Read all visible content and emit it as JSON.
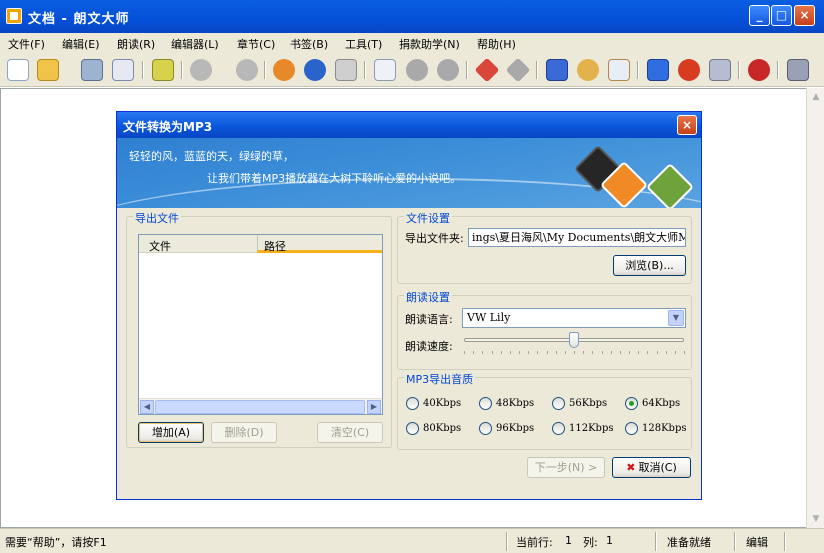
{
  "window": {
    "title": "文档 - 朗文大师"
  },
  "menu": [
    "文件(F)",
    "编辑(E)",
    "朗读(R)",
    "编辑器(L)",
    "章节(C)",
    "书签(B)",
    "工具(T)",
    "捐款助学(N)",
    "帮助(H)"
  ],
  "toolbar_icons": [
    "new-file-icon",
    "open-folder-icon",
    "save-icon",
    "edit-doc-icon",
    "convert-icon",
    "play-icon",
    "stop-icon",
    "voices-icon",
    "speed-icon",
    "volume-icon",
    "list-icon",
    "up-icon",
    "down-icon",
    "bookmark-icon",
    "bookmark-gray-icon",
    "font-icon",
    "palette-icon",
    "book-icon",
    "window-icon",
    "alarm-icon",
    "exit-icon",
    "donate-icon",
    "help-icon"
  ],
  "dialog": {
    "title": "文件转换为MP3",
    "banner_line1": "轻轻的风，蓝蓝的天，绿绿的草，",
    "banner_line2": "让我们带着MP3播放器在大树下聆听心爱的小说吧。",
    "export_group": {
      "title": "导出文件",
      "col_file": "文件",
      "col_path": "路径",
      "add_button": "增加(A)",
      "delete_button": "删除(D)",
      "clear_button": "清空(C)"
    },
    "file_settings": {
      "title": "文件设置",
      "folder_label": "导出文件夹:",
      "folder_value": "ings\\夏日海风\\My Documents\\朗文大师MP3\\",
      "browse_button": "浏览(B)..."
    },
    "read_settings": {
      "title": "朗读设置",
      "language_label": "朗读语言:",
      "language_value": "VW Lily",
      "speed_label": "朗读速度:",
      "speed_level": 0.5
    },
    "quality": {
      "title": "MP3导出音质",
      "options": [
        "40Kbps",
        "48Kbps",
        "56Kbps",
        "64Kbps",
        "80Kbps",
        "96Kbps",
        "112Kbps",
        "128Kbps"
      ],
      "selected": "64Kbps"
    },
    "next_button": "下一步(N) >",
    "cancel_button": "取消(C)"
  },
  "status": {
    "hint": "需要“帮助”，请按F1",
    "row_label": "当前行:",
    "row_value": "1",
    "col_label": "列:",
    "col_value": "1",
    "state": "准备就绪",
    "mode": "编辑"
  }
}
